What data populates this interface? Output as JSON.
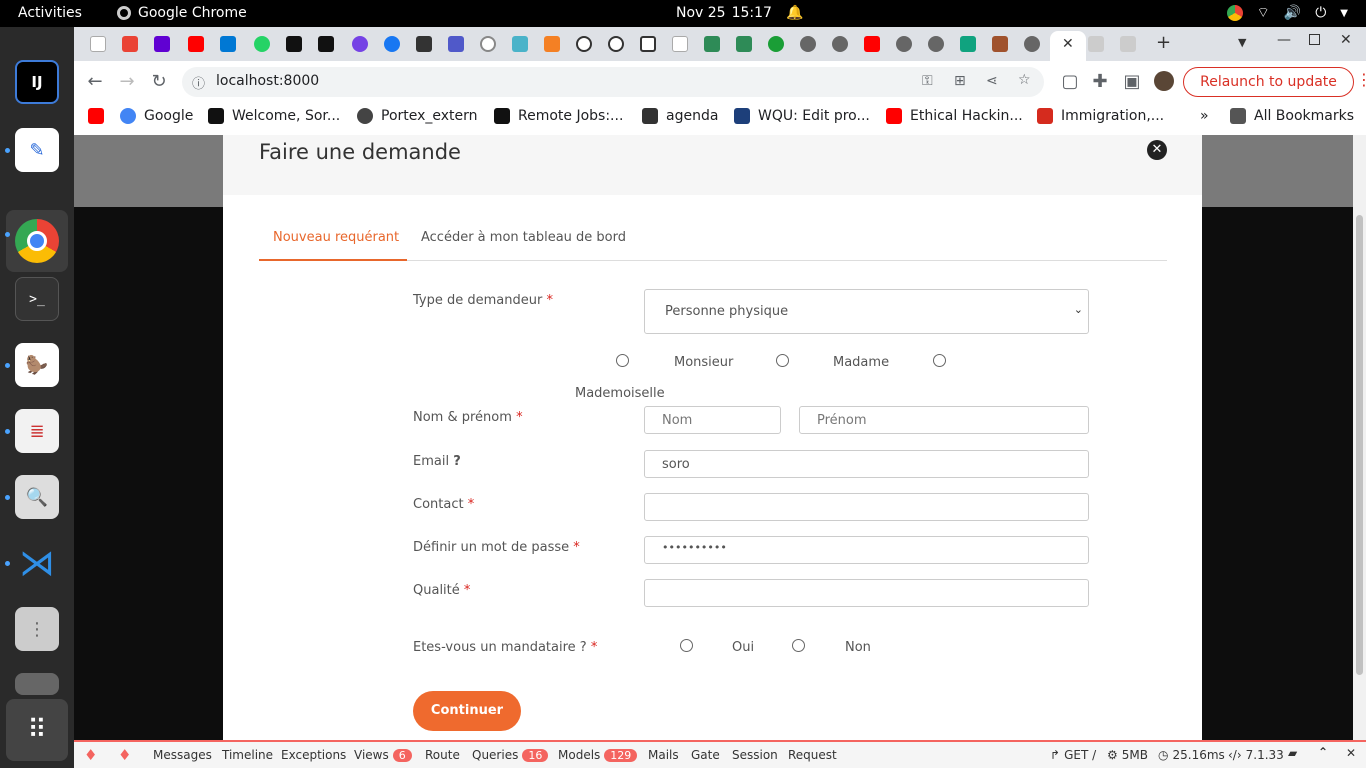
{
  "system": {
    "activities": "Activities",
    "app_name": "Google Chrome",
    "date": "Nov 25",
    "time": "15:17"
  },
  "browser": {
    "url": "localhost:8000",
    "relaunch": "Relaunch to update",
    "more_bookmarks": "»",
    "all_bookmarks": "All Bookmarks",
    "bookmarks": [
      {
        "label": "",
        "color": "#ff0000"
      },
      {
        "label": "Google",
        "color": "#4285f4"
      },
      {
        "label": "Welcome, Sor...",
        "color": "#111111"
      },
      {
        "label": "Portex_extern",
        "color": "#444444"
      },
      {
        "label": "Remote Jobs:...",
        "color": "#111111"
      },
      {
        "label": "agenda",
        "color": "#333333"
      },
      {
        "label": "WQU: Edit pro...",
        "color": "#1d3f7a"
      },
      {
        "label": "Ethical Hackin...",
        "color": "#ff0000"
      },
      {
        "label": "Immigration,...",
        "color": "#d52b1e"
      }
    ]
  },
  "modal": {
    "title": "Faire une demande",
    "tabs": [
      {
        "label": "Nouveau requérant"
      },
      {
        "label": "Accéder à mon tableau de bord"
      }
    ],
    "fields": {
      "type_label": "Type de demandeur",
      "type_value": "Personne physique",
      "civility_options": [
        "Monsieur",
        "Madame",
        "Mademoiselle"
      ],
      "name_label": "Nom & prénom",
      "nom_placeholder": "Nom",
      "prenom_placeholder": "Prénom",
      "email_label": "Email",
      "email_help": "?",
      "email_value": "soro",
      "contact_label": "Contact",
      "password_label": "Définir un mot de passe",
      "password_value": "••••••••••",
      "qualite_label": "Qualité",
      "mandataire_label": "Etes-vous un mandataire ?",
      "mandataire_options": [
        "Oui",
        "Non"
      ],
      "required_mark": "*"
    },
    "submit": "Continuer"
  },
  "debugbar": {
    "items": [
      {
        "label": "Messages"
      },
      {
        "label": "Timeline"
      },
      {
        "label": "Exceptions"
      },
      {
        "label": "Views",
        "count": "6"
      },
      {
        "label": "Route"
      },
      {
        "label": "Queries",
        "count": "16"
      },
      {
        "label": "Models",
        "count": "129"
      },
      {
        "label": "Mails"
      },
      {
        "label": "Gate"
      },
      {
        "label": "Session"
      },
      {
        "label": "Request"
      }
    ],
    "method": "GET /",
    "memory": "5MB",
    "duration": "25.16ms",
    "php": "7.1.33"
  }
}
